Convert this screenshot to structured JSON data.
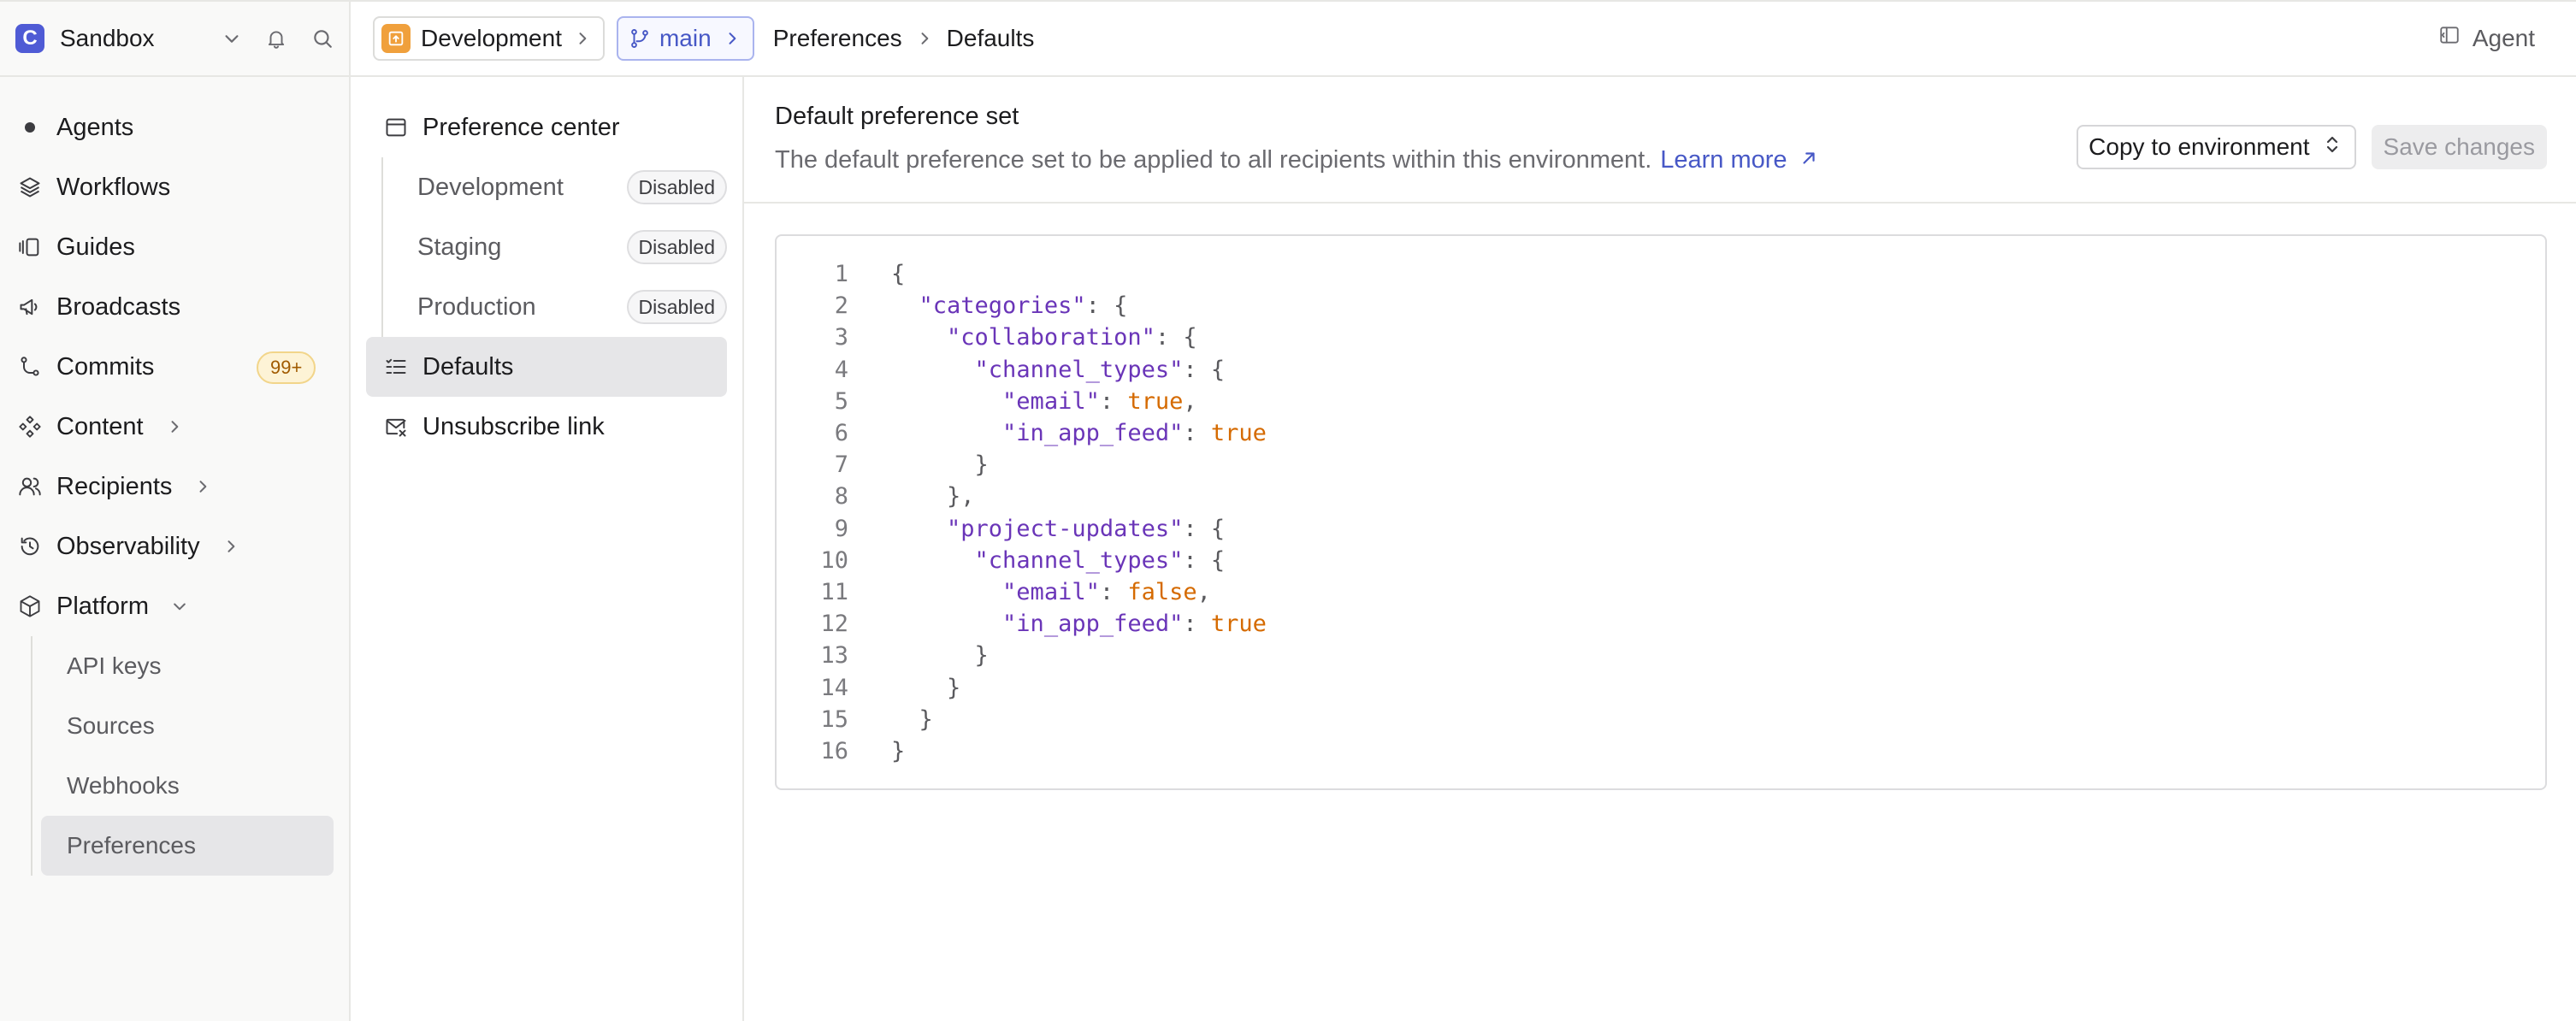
{
  "workspace": {
    "logo_letter": "C",
    "name": "Sandbox"
  },
  "sidebar": {
    "items": [
      {
        "label": "Agents",
        "icon": "dot-icon"
      },
      {
        "label": "Workflows",
        "icon": "layers-icon"
      },
      {
        "label": "Guides",
        "icon": "guides-icon"
      },
      {
        "label": "Broadcasts",
        "icon": "megaphone-icon"
      },
      {
        "label": "Commits",
        "icon": "commit-icon",
        "badge": "99+"
      },
      {
        "label": "Content",
        "icon": "content-icon"
      },
      {
        "label": "Recipients",
        "icon": "users-icon"
      },
      {
        "label": "Observability",
        "icon": "history-icon"
      },
      {
        "label": "Platform",
        "icon": "box-icon"
      }
    ],
    "platform_children": [
      "API keys",
      "Sources",
      "Webhooks",
      "Preferences"
    ],
    "active_child": "Preferences"
  },
  "topbar": {
    "environment": "Development",
    "branch": "main",
    "breadcrumb": [
      "Preferences",
      "Defaults"
    ],
    "agent_label": "Agent"
  },
  "prefs_nav": {
    "center_label": "Preference center",
    "environments": [
      {
        "label": "Development",
        "status": "Disabled"
      },
      {
        "label": "Staging",
        "status": "Disabled"
      },
      {
        "label": "Production",
        "status": "Disabled"
      }
    ],
    "defaults_label": "Defaults",
    "unsubscribe_label": "Unsubscribe link"
  },
  "pane": {
    "title": "Default preference set",
    "description": "The default preference set to be applied to all recipients within this environment.",
    "learn_more": "Learn more",
    "copy_button": "Copy to environment",
    "save_button": "Save changes"
  },
  "editor": {
    "line_numbers": [
      "1",
      "2",
      "3",
      "4",
      "5",
      "6",
      "7",
      "8",
      "9",
      "10",
      "11",
      "12",
      "13",
      "14",
      "15",
      "16"
    ],
    "json": {
      "categories": {
        "collaboration": {
          "channel_types": {
            "email": true,
            "in_app_feed": true
          }
        },
        "project-updates": {
          "channel_types": {
            "email": false,
            "in_app_feed": true
          }
        }
      }
    }
  },
  "colors": {
    "accent": "#4758c6",
    "logo": "#4f5bd5",
    "env_badge": "#f0a03c",
    "json_key": "#6a35b8",
    "json_bool": "#d56a00"
  }
}
